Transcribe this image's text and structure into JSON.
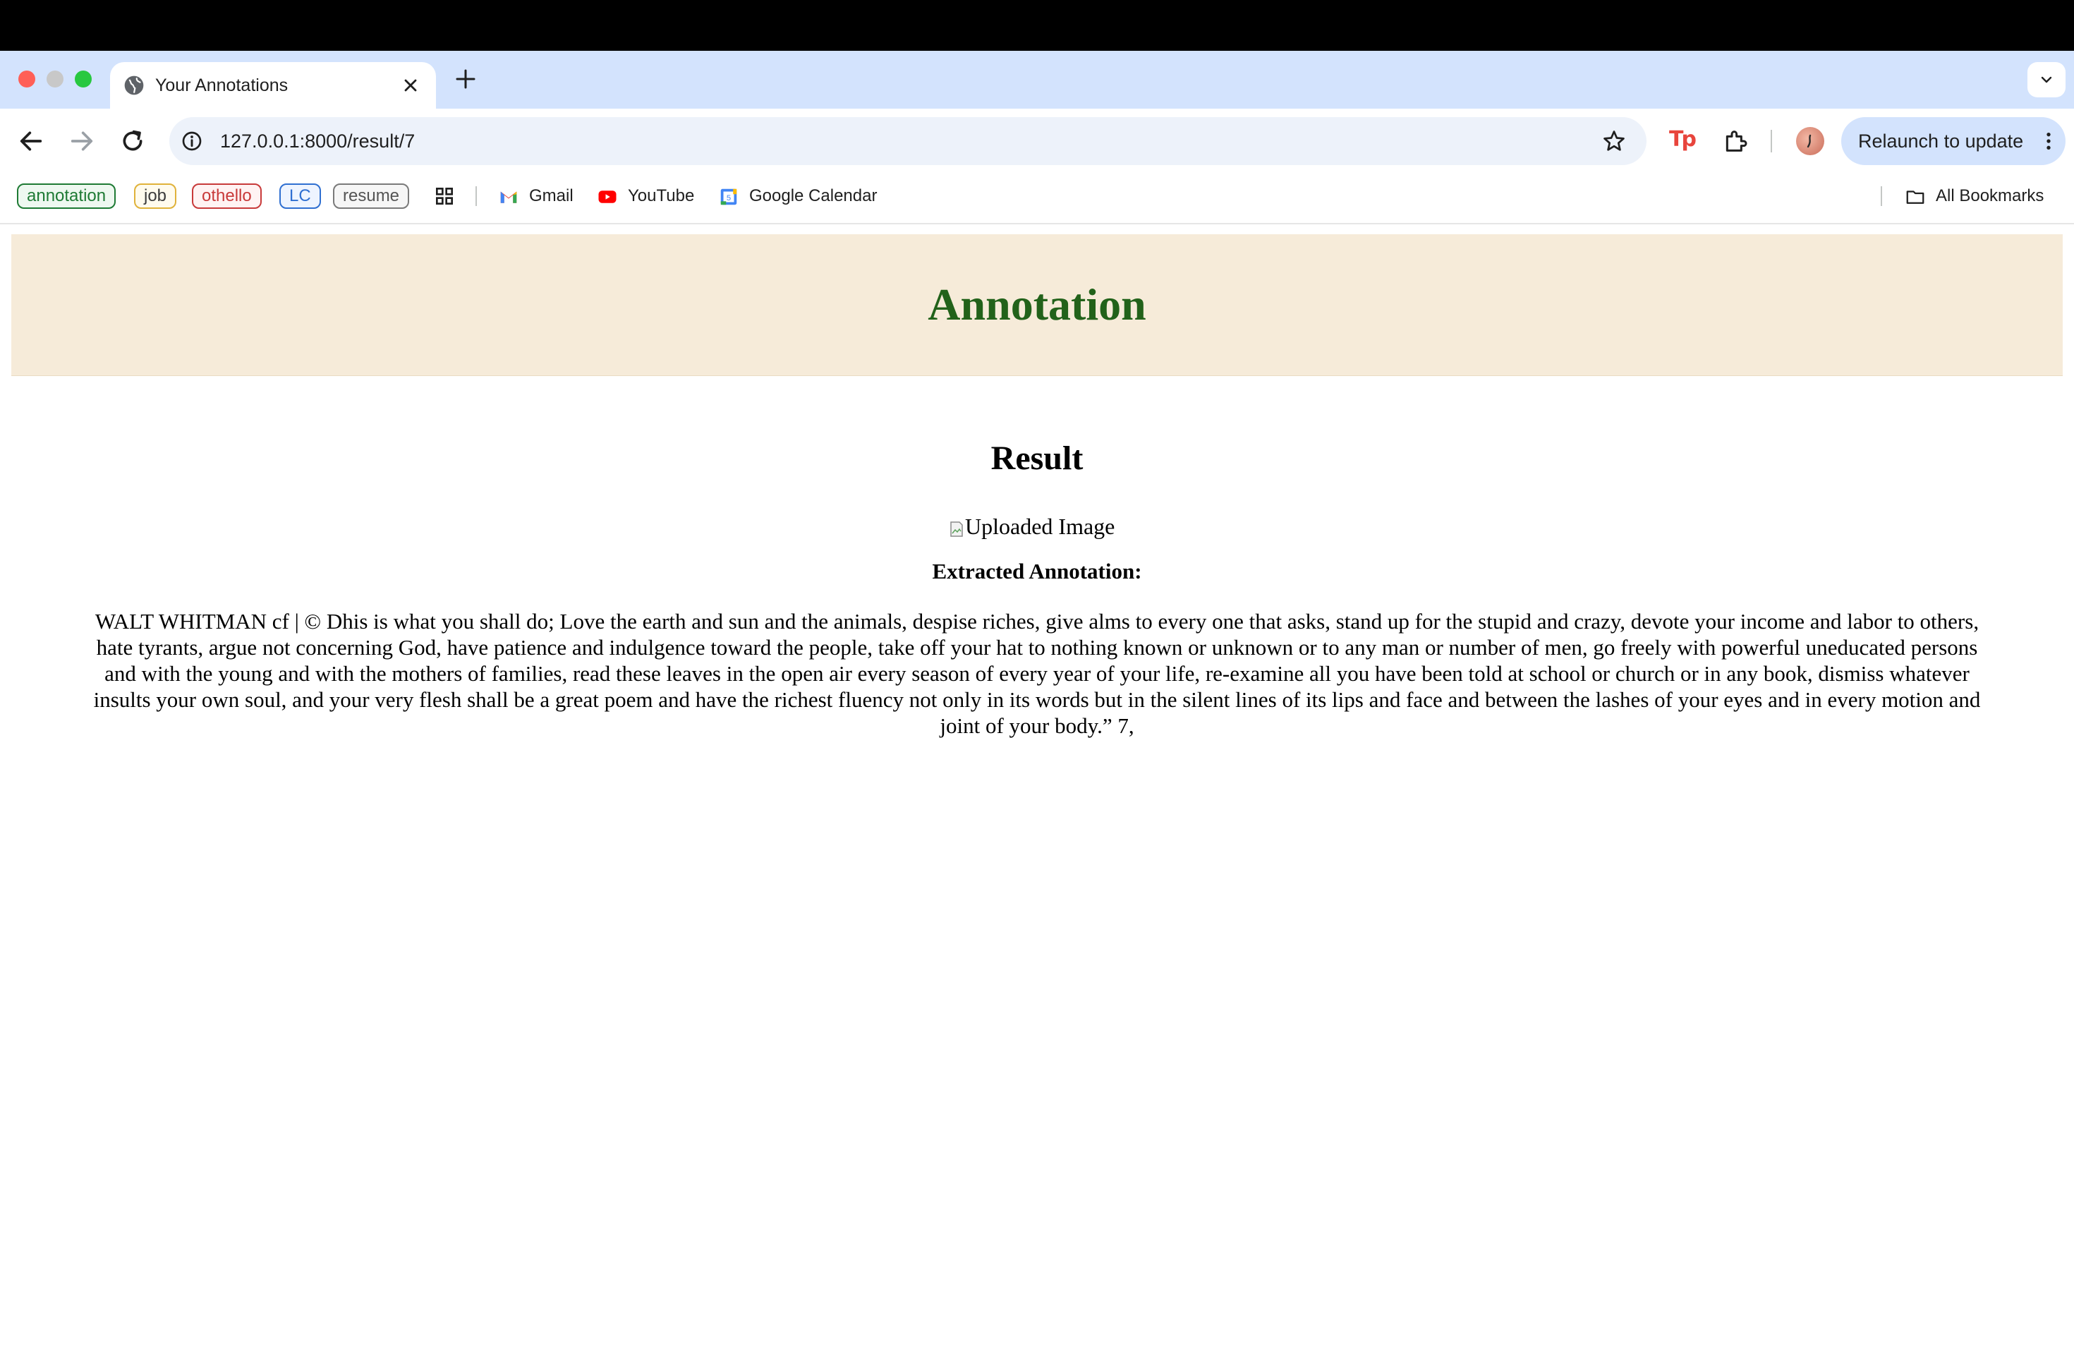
{
  "browser": {
    "tab": {
      "title": "Your Annotations"
    },
    "address": {
      "url": "127.0.0.1:8000/result/7"
    },
    "relaunch_label": "Relaunch to update",
    "extension_label": "Tp",
    "bookmarks": {
      "chips": [
        "annotation",
        "job",
        "othello",
        "LC",
        "resume"
      ],
      "links": [
        "Gmail",
        "YouTube",
        "Google Calendar"
      ],
      "all_label": "All Bookmarks"
    }
  },
  "page": {
    "header_title": "Annotation",
    "result_heading": "Result",
    "image_alt": "Uploaded Image",
    "extracted_label": "Extracted Annotation:",
    "extracted_text": "WALT WHITMAN cf | © Dhis is what you shall do; Love the earth and sun and the animals, despise riches, give alms to every one that asks, stand up for the stupid and crazy, devote your income and labor to others, hate tyrants, argue not concerning God, have patience and indulgence toward the people, take off your hat to nothing known or unknown or to any man or number of men, go freely with powerful uneducated persons and with the young and with the mothers of families, read these leaves in the open air every season of every year of your life, re-examine all you have been told at school or church or in any book, dismiss whatever insults your own soul, and your very flesh shall be a great poem and have the richest fluency not only in its words but in the silent lines of its lips and face and between the lashes of your eyes and in every motion and joint of your body.” 7,",
    "colors": {
      "header_bg": "#f6ebd9",
      "header_text": "#22621a"
    }
  }
}
